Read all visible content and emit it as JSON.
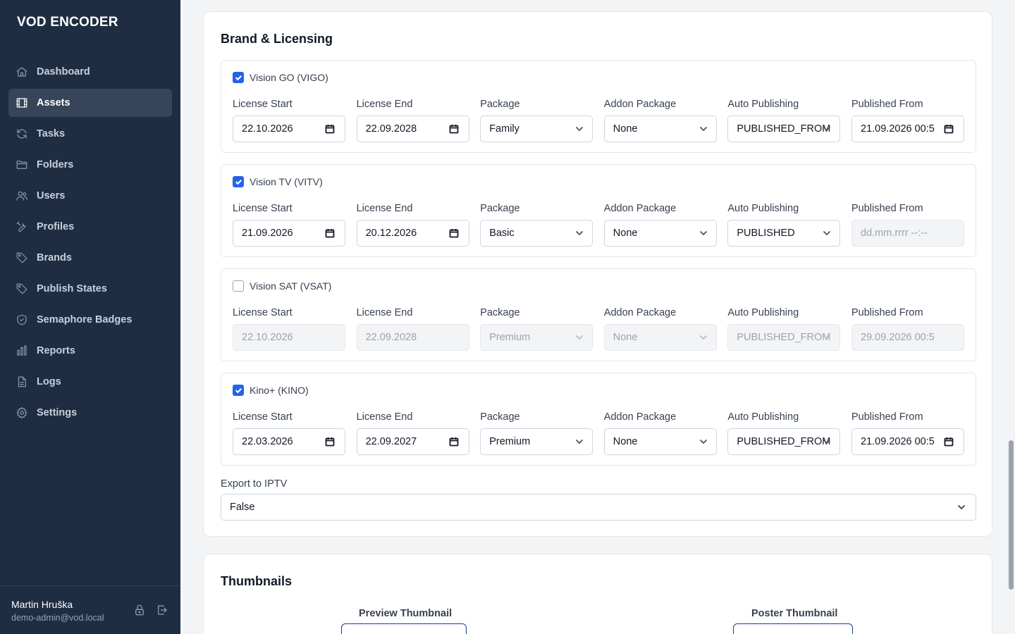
{
  "app": {
    "title": "VOD ENCODER"
  },
  "sidebar": {
    "items": [
      {
        "label": "Dashboard",
        "icon": "home-icon",
        "active": false
      },
      {
        "label": "Assets",
        "icon": "film-icon",
        "active": true
      },
      {
        "label": "Tasks",
        "icon": "refresh-icon",
        "active": false
      },
      {
        "label": "Folders",
        "icon": "folder-icon",
        "active": false
      },
      {
        "label": "Users",
        "icon": "users-icon",
        "active": false
      },
      {
        "label": "Profiles",
        "icon": "tools-icon",
        "active": false
      },
      {
        "label": "Brands",
        "icon": "tag-icon",
        "active": false
      },
      {
        "label": "Publish States",
        "icon": "tag-icon",
        "active": false
      },
      {
        "label": "Semaphore Badges",
        "icon": "shield-icon",
        "active": false
      },
      {
        "label": "Reports",
        "icon": "bar-chart-icon",
        "active": false
      },
      {
        "label": "Logs",
        "icon": "document-icon",
        "active": false
      },
      {
        "label": "Settings",
        "icon": "gear-icon",
        "active": false
      }
    ],
    "user": {
      "name": "Martin Hruška",
      "email": "demo-admin@vod.local"
    }
  },
  "brand_licensing": {
    "title": "Brand & Licensing",
    "field_labels": [
      "License Start",
      "License End",
      "Package",
      "Addon Package",
      "Auto Publishing",
      "Published From"
    ],
    "brands": [
      {
        "name": "Vision GO (VIGO)",
        "checked": true,
        "license_start": "22.10.2026",
        "license_end": "22.09.2028",
        "package": "Family",
        "addon_package": "None",
        "auto_publishing": "PUBLISHED_FROM",
        "published_from": "21.09.2026 00:5",
        "published_from_placeholder": false
      },
      {
        "name": "Vision TV (VITV)",
        "checked": true,
        "license_start": "21.09.2026",
        "license_end": "20.12.2026",
        "package": "Basic",
        "addon_package": "None",
        "auto_publishing": "PUBLISHED",
        "published_from": "dd.mm.rrrr --:--",
        "published_from_placeholder": true
      },
      {
        "name": "Vision SAT (VSAT)",
        "checked": false,
        "license_start": "22.10.2026",
        "license_end": "22.09.2028",
        "package": "Premium",
        "addon_package": "None",
        "auto_publishing": "PUBLISHED_FROM",
        "published_from": "29.09.2026 00:5",
        "published_from_placeholder": false
      },
      {
        "name": "Kino+ (KINO)",
        "checked": true,
        "license_start": "22.03.2026",
        "license_end": "22.09.2027",
        "package": "Premium",
        "addon_package": "None",
        "auto_publishing": "PUBLISHED_FROM",
        "published_from": "21.09.2026 00:5",
        "published_from_placeholder": false
      }
    ],
    "export_iptv": {
      "label": "Export to IPTV",
      "value": "False"
    }
  },
  "thumbnails": {
    "title": "Thumbnails",
    "preview_label": "Preview Thumbnail",
    "poster_label": "Poster Thumbnail"
  }
}
